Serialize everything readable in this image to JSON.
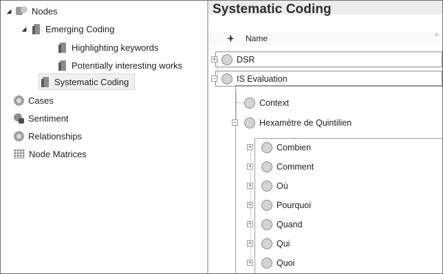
{
  "nav": {
    "items": [
      {
        "label": "Nodes",
        "icon": "nodes-icon",
        "expander": "◢"
      },
      {
        "label": "Emerging Coding",
        "icon": "folder-icon",
        "expander": "◢"
      },
      {
        "label": "Highlighting keywords",
        "icon": "folder-icon"
      },
      {
        "label": "Potentially interesting works",
        "icon": "folder-icon"
      },
      {
        "label": "Systematic Coding",
        "icon": "folder-icon",
        "selected": true
      },
      {
        "label": "Cases",
        "icon": "cases-icon"
      },
      {
        "label": "Sentiment",
        "icon": "sentiment-icon"
      },
      {
        "label": "Relationships",
        "icon": "relationships-icon"
      },
      {
        "label": "Node Matrices",
        "icon": "node-matrices-icon"
      }
    ]
  },
  "detail": {
    "title": "Systematic Coding",
    "column_name": "Name",
    "sort_indicator": "^",
    "rows": [
      {
        "label": "DSR",
        "expander": "+"
      },
      {
        "label": "IS Evaluation",
        "expander": "−"
      },
      {
        "label": "Context"
      },
      {
        "label": "Hexamètre de Quintilien",
        "expander": "−"
      },
      {
        "label": "Combien",
        "expander": "+"
      },
      {
        "label": "Comment",
        "expander": "+"
      },
      {
        "label": "Où",
        "expander": "+"
      },
      {
        "label": "Pourquoi",
        "expander": "+"
      },
      {
        "label": "Quand",
        "expander": "+"
      },
      {
        "label": "Qui",
        "expander": "+"
      },
      {
        "label": "Quoi",
        "expander": "+"
      }
    ]
  },
  "colors": {
    "selection_bg": "#f0f0f0",
    "node_fill": "#d4d4d4",
    "frame": "#6e6e6e"
  }
}
